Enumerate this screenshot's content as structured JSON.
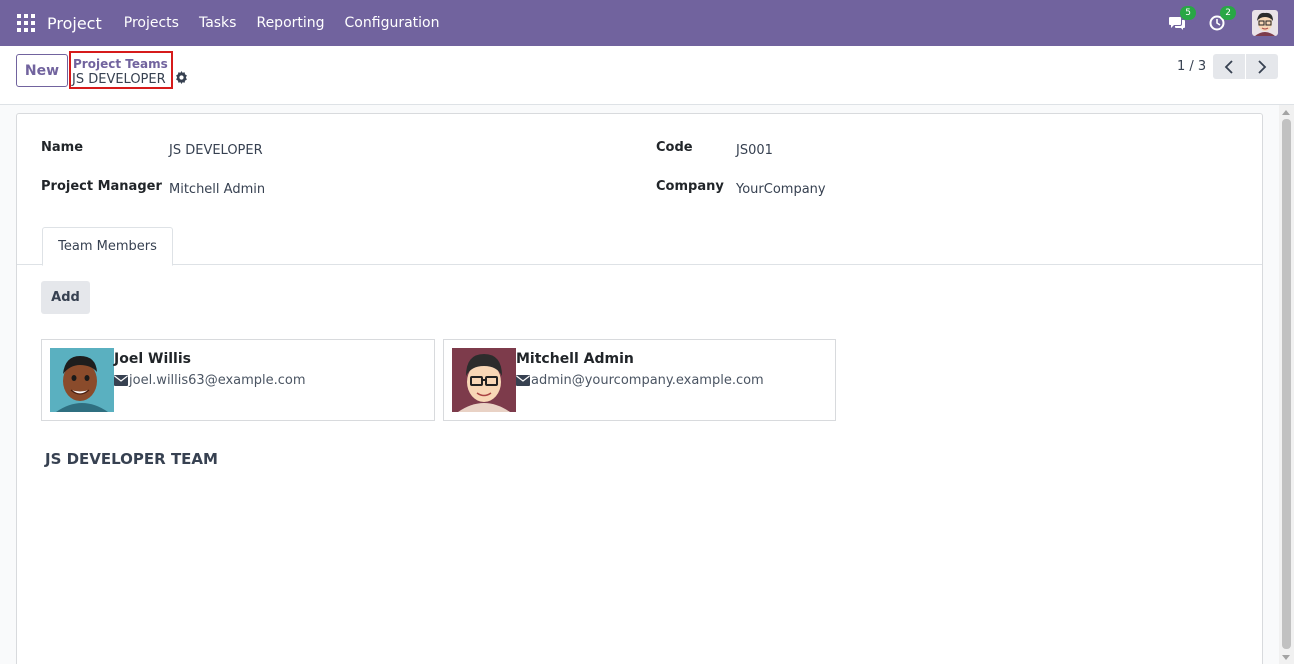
{
  "navbar": {
    "app_name": "Project",
    "menu": [
      "Projects",
      "Tasks",
      "Reporting",
      "Configuration"
    ],
    "messages_count": "5",
    "activities_count": "2",
    "icons": [
      "apps-grid-icon",
      "chat-icon",
      "clock-icon",
      "user-avatar"
    ],
    "accent_color": "#71639e"
  },
  "control_panel": {
    "new_label": "New",
    "breadcrumb_parent": "Project Teams",
    "breadcrumb_current": "JS DEVELOPER",
    "pager": "1 / 3"
  },
  "form": {
    "name_label": "Name",
    "name_value": "JS DEVELOPER",
    "manager_label": "Project Manager",
    "manager_value": "Mitchell Admin",
    "code_label": "Code",
    "code_value": "JS001",
    "company_label": "Company",
    "company_value": "YourCompany"
  },
  "tabs": {
    "active": "Team Members"
  },
  "team": {
    "add_label": "Add",
    "members": [
      {
        "name": "Joel Willis",
        "email": "joel.willis63@example.com"
      },
      {
        "name": "Mitchell Admin",
        "email": "admin@yourcompany.example.com"
      }
    ],
    "heading": "JS DEVELOPER TEAM"
  }
}
